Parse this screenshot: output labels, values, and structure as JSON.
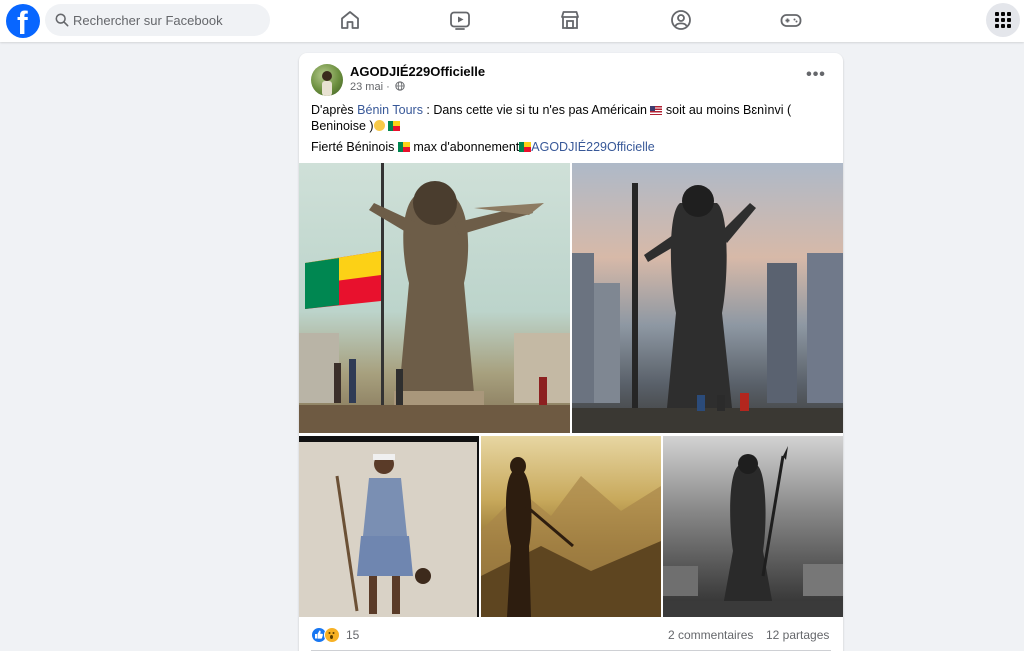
{
  "topbar": {
    "search_placeholder": "Rechercher sur Facebook",
    "logo_letter": "f",
    "nav_icons": [
      "home-icon",
      "video-icon",
      "marketplace-icon",
      "groups-icon",
      "gaming-icon"
    ],
    "menu_icon": "grid-menu-icon"
  },
  "post": {
    "author": "AGODJIÉ229Officielle",
    "date": "23 mai",
    "separator": "·",
    "more_label": "•••",
    "line1": {
      "prefix": "D'après ",
      "link": "Bénin Tours",
      "middle": " : Dans cette vie si tu n'es pas Américain ",
      "after_us_flag": " soit au moins Bɛnìnvi ( Beninoise )"
    },
    "line2": {
      "prefix": "Fierté Béninois ",
      "middle": " max d'abonnement",
      "link": "AGODJIÉ229Officielle"
    },
    "photos": [
      "statue-woman-benin-flag",
      "statue-warrior-city",
      "drawing-amazon-warrior",
      "silhouette-warrior-mountains",
      "warrior-statue-spear-bw"
    ],
    "reactions": {
      "count": "15",
      "comments": "2 commentaires",
      "shares": "12 partages"
    }
  },
  "colors": {
    "brand": "#0866ff",
    "link": "#385898",
    "page_bg": "#f0f2f5"
  }
}
